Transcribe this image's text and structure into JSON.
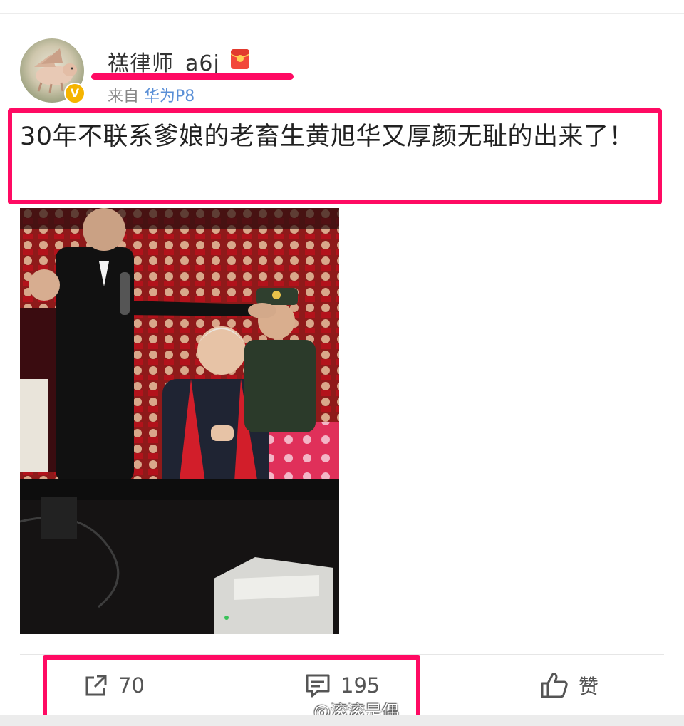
{
  "post": {
    "username": "禚律师_a6j",
    "source_prefix": "来自",
    "source_device": "华为P8",
    "verified_mark": "V",
    "text": "30年不联系爹娘的老畜生黄旭华又厚颜无耻的出来了！"
  },
  "actions": {
    "repost_count": "70",
    "comment_count": "195",
    "like_label": "赞"
  },
  "watermark": {
    "text": "@滚滚是偶"
  },
  "icons": {
    "repost": "share-arrow-icon",
    "comment": "comment-bubble-icon",
    "like": "thumbs-up-icon",
    "badge": "verified-badge-icon",
    "red_packet": "red-packet-icon",
    "weibo": "weibo-logo-icon"
  },
  "colors": {
    "highlight": "#ff0a63",
    "link_blue": "#5a8fd6",
    "verified": "#f5b400",
    "red_packet": "#f2473a"
  }
}
